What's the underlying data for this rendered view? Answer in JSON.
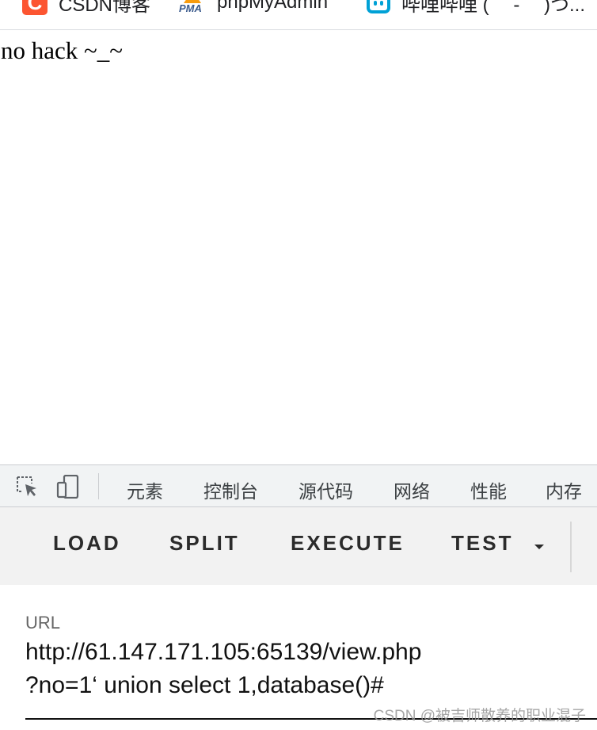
{
  "bookmarks": [
    {
      "icon": "csdn-logo-icon",
      "label": "CSDN博客"
    },
    {
      "icon": "phpmyadmin-logo-icon",
      "label": "phpMyAdmin"
    },
    {
      "icon": "bilibili-logo-icon",
      "label": "哔哩哔哩 ( ゜- ゜)つ..."
    }
  ],
  "page": {
    "message": "no hack ~_~"
  },
  "devtools": {
    "tabs": [
      "元素",
      "控制台",
      "源代码",
      "网络",
      "性能",
      "内存"
    ]
  },
  "hackbar": {
    "buttons": [
      "LOAD",
      "SPLIT",
      "EXECUTE",
      "TEST"
    ],
    "url_label": "URL",
    "url_value": "http://61.147.171.105:65139/view.php\n?no=1‘ union select 1,database()#"
  },
  "watermark": "CSDN @被吉师散养的职业混子",
  "colors": {
    "csdn": "#fc5531",
    "pma_orange": "#f89c0e",
    "bilibili": "#00a1d6"
  }
}
